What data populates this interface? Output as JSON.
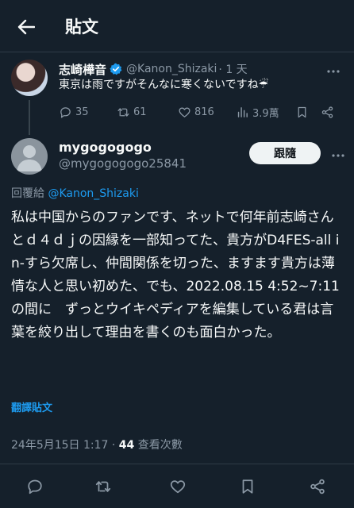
{
  "header": {
    "title": "貼文"
  },
  "parent_tweet": {
    "name": "志崎樺音",
    "handle": "@Kanon_Shizaki",
    "time": "· 1 天",
    "text": "東京は雨ですがそんなに寒くないですね☔",
    "replies": "35",
    "retweets": "61",
    "likes": "816",
    "views": "3.9萬"
  },
  "reply_tweet": {
    "name": "mygogogogo",
    "handle": "@mygogogogo25841",
    "follow_label": "跟隨",
    "reply_to_prefix": "回覆給 ",
    "reply_to_handle": "@Kanon_Shizaki",
    "text": "私は中国からのファンです、ネットで何年前志崎さんとｄ４ｄｊの因縁を一部知ってた、貴方がD4FES-all in-すら欠席し、仲間関係を切った、ますます貴方は薄情な人と思い初めた、でも、2022.08.15 4:52~7:11 の間に　ずっとウイキペディアを編集している君は言葉を絞り出して理由を書くのも面白かった。",
    "translate_label": "翻譯貼文",
    "timestamp": "24年5月15日 1:17 · ",
    "views_count": "44",
    "views_label": " 查看次數"
  },
  "colors": {
    "background": "#15202b",
    "accent": "#1d9bf0",
    "muted": "#8b98a5"
  },
  "icons": [
    "back-arrow-icon",
    "verified-badge-icon",
    "more-icon",
    "reply-icon",
    "retweet-icon",
    "like-icon",
    "views-icon",
    "bookmark-icon",
    "share-icon"
  ]
}
